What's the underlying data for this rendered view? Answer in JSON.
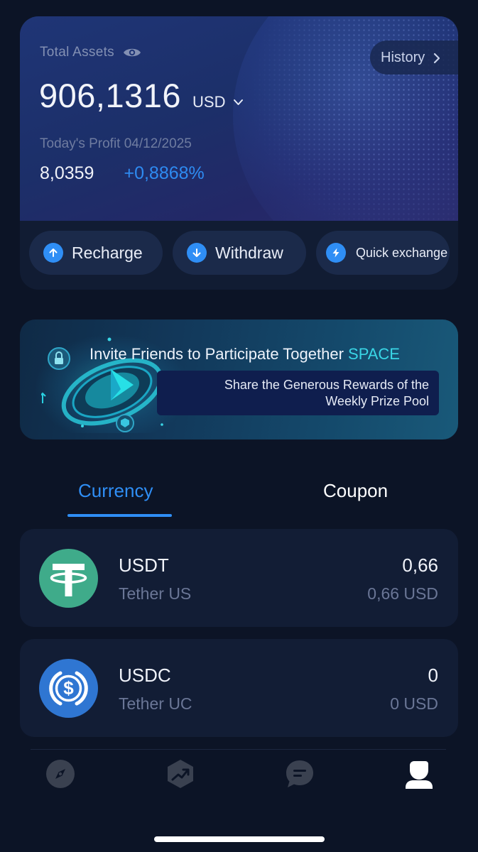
{
  "assets": {
    "total_label": "Total Assets",
    "total_value": "906,1316",
    "currency": "USD",
    "history_label": "History",
    "profit_label": "Today's Profit 04/12/2025",
    "profit_value": "8,0359",
    "profit_percent": "+0,8868%"
  },
  "actions": {
    "recharge": "Recharge",
    "withdraw": "Withdraw",
    "quick_exchange": "Quick exchange"
  },
  "banner": {
    "title": "Invite Friends to Participate Together",
    "title_highlight": "SPACE",
    "subtitle_line1": "Share the Generous Rewards of the",
    "subtitle_line2": "Weekly Prize Pool"
  },
  "tabs": {
    "currency": "Currency",
    "coupon": "Coupon",
    "active": "Currency"
  },
  "coins": [
    {
      "symbol": "USDT",
      "name": "Tether US",
      "amount": "0,66",
      "usd_value": "0,66 USD",
      "icon": "tether-icon",
      "color": "#3fab8a"
    },
    {
      "symbol": "USDC",
      "name": "Tether UC",
      "amount": "0",
      "usd_value": "0 USD",
      "icon": "usdc-icon",
      "color": "#2f76d2"
    }
  ],
  "nav": {
    "items": [
      "compass-icon",
      "trend-icon",
      "chat-icon",
      "profile-icon"
    ],
    "active": "profile-icon"
  },
  "colors": {
    "background": "#0c1426",
    "accent": "#2f8ef5",
    "card": "#121d35",
    "highlight": "#39d6e6"
  }
}
